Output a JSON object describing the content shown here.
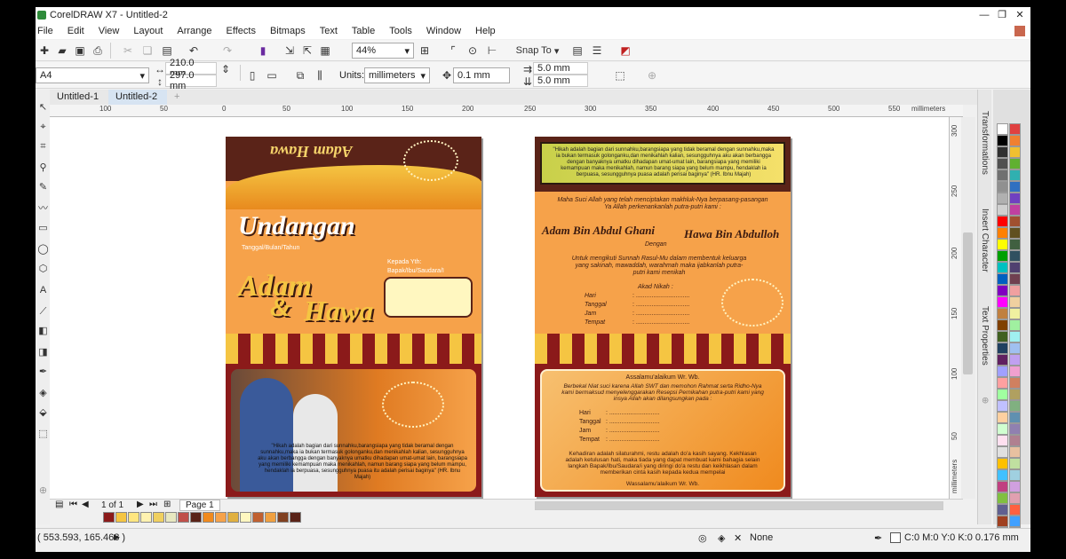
{
  "app": {
    "title": "CorelDRAW X7 - Untitled-2"
  },
  "menu": [
    "File",
    "Edit",
    "View",
    "Layout",
    "Arrange",
    "Effects",
    "Bitmaps",
    "Text",
    "Table",
    "Tools",
    "Window",
    "Help"
  ],
  "toolbar": {
    "zoom": "44%",
    "snap_to": "Snap To"
  },
  "property_bar": {
    "page_size": "A4",
    "width": "210.0 mm",
    "height": "297.0 mm",
    "units_label": "Units:",
    "units_value": "millimeters",
    "nudge": "0.1 mm",
    "dup_x": "5.0 mm",
    "dup_y": "5.0 mm"
  },
  "tabs": [
    "Untitled-1",
    "Untitled-2"
  ],
  "rulers": {
    "h_labels": [
      "100",
      "50",
      "0",
      "50",
      "100",
      "150",
      "200",
      "250",
      "300",
      "350",
      "400",
      "450",
      "500",
      "550"
    ],
    "h_unit": "millimeters",
    "v_labels": [
      "300",
      "250",
      "200",
      "150",
      "100",
      "50"
    ],
    "v_unit": "millimeters"
  },
  "dockers": [
    "Transformations",
    "Insert Character",
    "Text Properties"
  ],
  "navigator": {
    "page_count": "1 of 1",
    "page_tab": "Page 1"
  },
  "status": {
    "coords": "( 553.593, 165.468 )",
    "fill_label": "None",
    "outline": "C:0 M:0 Y:0 K:0  0.176 mm"
  },
  "design": {
    "front_title_arabic_style": "Adam Hawa",
    "undangan": "Undangan",
    "tanggal": "Tanggal/Bulan/Tahun",
    "kepada": "Kepada Yth:",
    "bapak": "Bapak/Ibu/Saudara/I",
    "names_front_1": "Adam",
    "names_front_amp": "&",
    "names_front_2": "Hawa",
    "front_quote": "\"Hikah adalah bagian dari sunnahku,barangsiapa yang tidak beramal dengan sunnahku,maka ia bukan termasuk golonganku,dan menikahlah kalian, sesungguhnya aku akan berbangga dengan banyaknya umatku dihadapan umat-umat lain, barangsiapa yang memiliki kemampuan maka menikahlah, namun barang siapa yang belum mampu, hendaklah ia berpuasa, sesungguhnya puasa itu adalah perisai baginya\" (HR. Ibnu Majah)",
    "inner_quote": "\"Hikah adalah bagian dari sunnahku,barangsiapa yang tidak beramal dengan sunnahku,maka ia bukan termasuk golonganku,dan menikahlah kalian, sesungguhnya aku akan berbangga dengan banyaknya umatku dihadapan umat-umat lain, barangsiapa yang memiliki kemampuan maka menikahlah, namun barang siapa yang belum mampu, hendaklah ia berpuasa, sesungguhnya puasa adalah perisai baginya\" (HR. Ibnu Majah)",
    "maha_suci": "Maha Suci Allah yang telah menciptakan makhluk-Nya berpasang-pasangan Ya Allah perkenankanlah putra-putri kami :",
    "groom": "Adam Bin Abdul Ghani",
    "dengan": "Dengan",
    "bride": "Hawa Bin Abdulloh",
    "untuk": "Untuk mengikuti Sunnah Rasul-Mu dalam membentuk keluarga yang sakinah, mawaddah, warahmah maka ijabkanlah putra-putri kami menikah",
    "akad": "Akad Nikah :",
    "hari": "Hari",
    "tanggal_l": "Tanggal",
    "jam": "Jam",
    "tempat": "Tempat",
    "dots": ": ...............................",
    "salam": "Assalamu'alaikum Wr. Wb.",
    "berbekal": "Berbekal Niat suci karena Allah SWT dan memohon Rahmat serta Ridho-Nya kami bermaksud menyelenggarakan Resepsi Pernikahan putra-putri kami yang insya Allah akan dilangsungkan pada :",
    "dots2": ": .............................",
    "kehadiran": "Kehadiran adalah silaturahmi, restu adalah do'a kasih sayang. Kekhlasan adalah ketulusan hati, maka tiada yang dapat membuat kami bahagia selain langkah Bapak/Ibu/Saudara/i yang diringi do'a restu dan keikhlasan dalam memberikan cinta kasih kepada kedua mempelai",
    "wassalam": "Wassalamu'alaikum Wr. Wb."
  },
  "colors": {
    "accent": "#f6a24a",
    "dark_red": "#8b1a1a",
    "brown": "#5a2318",
    "gold": "#f5c542"
  }
}
